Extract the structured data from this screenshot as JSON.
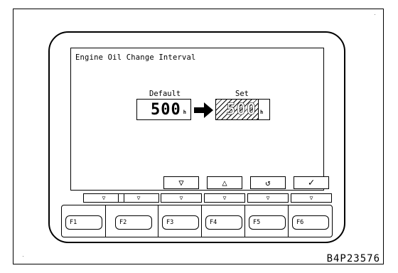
{
  "screen": {
    "title": "Engine Oil Change Interval",
    "default_caption": "Default",
    "set_caption": "Set",
    "default_value": "500",
    "set_value": "500",
    "unit": "h"
  },
  "soft_buttons": [
    {
      "icon": "down-triangle-icon",
      "glyph": "▽"
    },
    {
      "icon": "up-triangle-icon",
      "glyph": "△"
    },
    {
      "icon": "return-icon",
      "glyph": "↺"
    },
    {
      "icon": "check-icon",
      "glyph": "✓"
    }
  ],
  "indicators": [
    "▽",
    "▽",
    "▽",
    "▽",
    "▽",
    "▽"
  ],
  "function_keys": [
    "F1",
    "F2",
    "F3",
    "F4",
    "F5",
    "F6"
  ],
  "figure_code": "B4P23576"
}
